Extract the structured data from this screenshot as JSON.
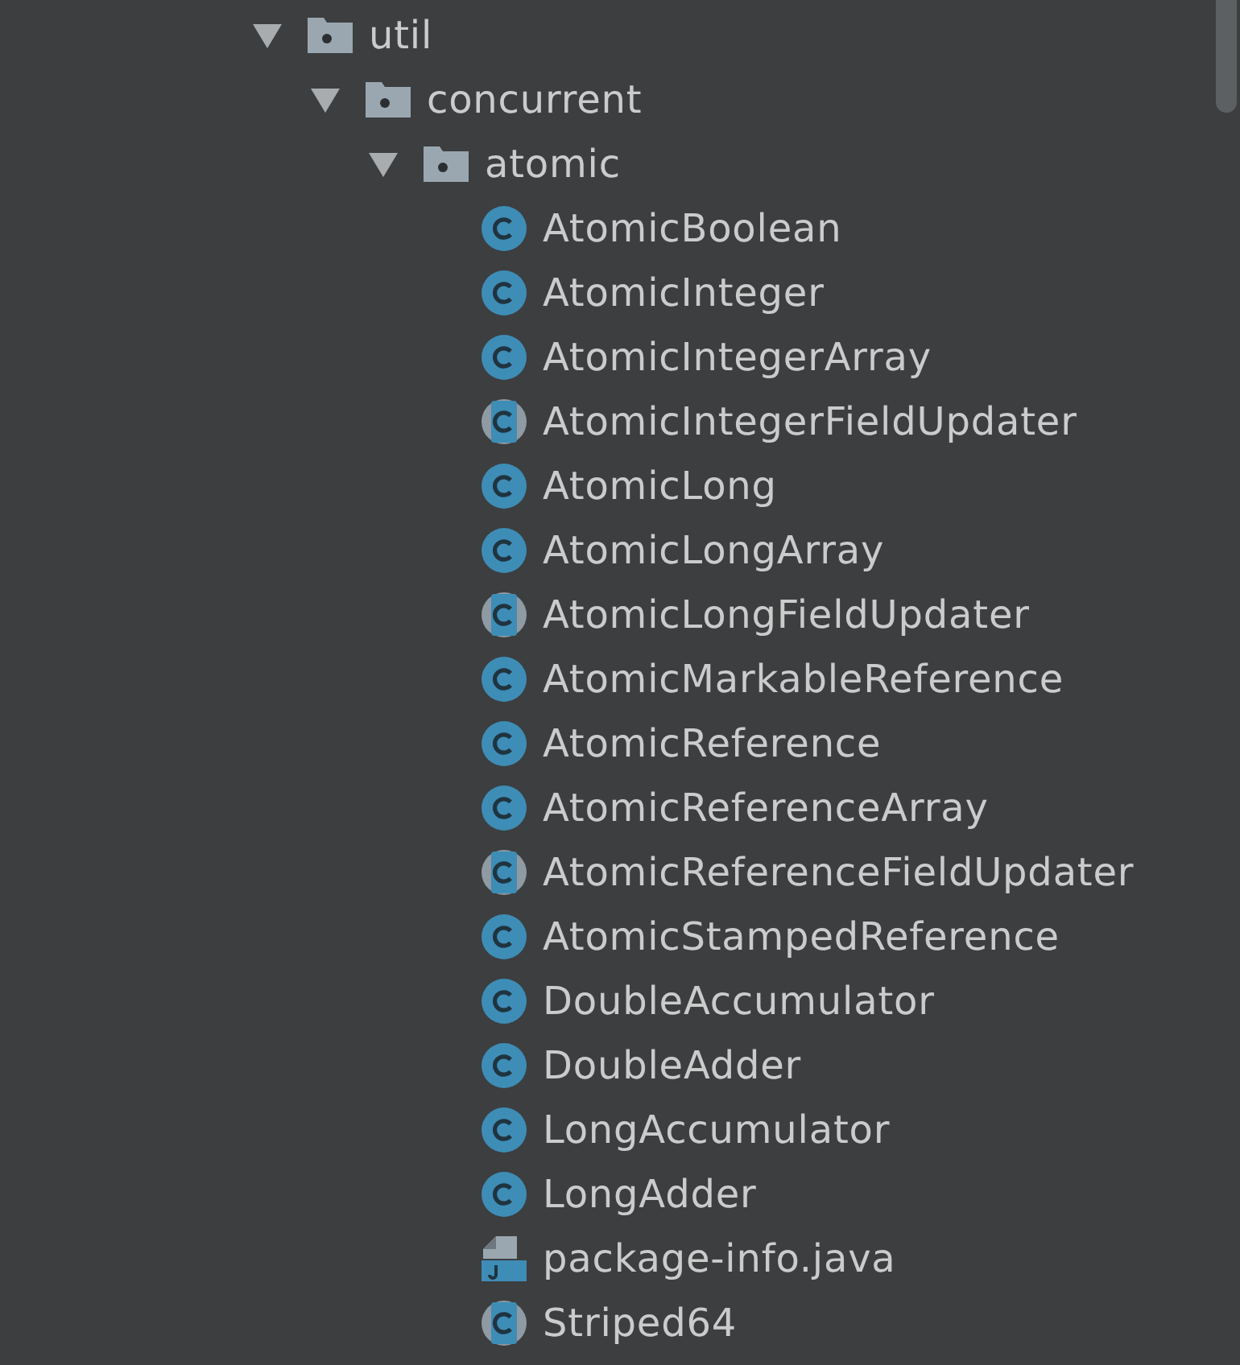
{
  "tree": [
    {
      "label": "util",
      "kind": "package",
      "expanded": true,
      "children": [
        {
          "label": "concurrent",
          "kind": "package",
          "expanded": true,
          "children": [
            {
              "label": "atomic",
              "kind": "package",
              "expanded": true,
              "children": [
                {
                  "label": "AtomicBoolean",
                  "kind": "class"
                },
                {
                  "label": "AtomicInteger",
                  "kind": "class"
                },
                {
                  "label": "AtomicIntegerArray",
                  "kind": "class"
                },
                {
                  "label": "AtomicIntegerFieldUpdater",
                  "kind": "abstract_class"
                },
                {
                  "label": "AtomicLong",
                  "kind": "class"
                },
                {
                  "label": "AtomicLongArray",
                  "kind": "class"
                },
                {
                  "label": "AtomicLongFieldUpdater",
                  "kind": "abstract_class"
                },
                {
                  "label": "AtomicMarkableReference",
                  "kind": "class"
                },
                {
                  "label": "AtomicReference",
                  "kind": "class"
                },
                {
                  "label": "AtomicReferenceArray",
                  "kind": "class"
                },
                {
                  "label": "AtomicReferenceFieldUpdater",
                  "kind": "abstract_class"
                },
                {
                  "label": "AtomicStampedReference",
                  "kind": "class"
                },
                {
                  "label": "DoubleAccumulator",
                  "kind": "class"
                },
                {
                  "label": "DoubleAdder",
                  "kind": "class"
                },
                {
                  "label": "LongAccumulator",
                  "kind": "class"
                },
                {
                  "label": "LongAdder",
                  "kind": "class"
                },
                {
                  "label": "package-info.java",
                  "kind": "java_file"
                },
                {
                  "label": "Striped64",
                  "kind": "abstract_class"
                }
              ]
            }
          ]
        }
      ]
    }
  ]
}
